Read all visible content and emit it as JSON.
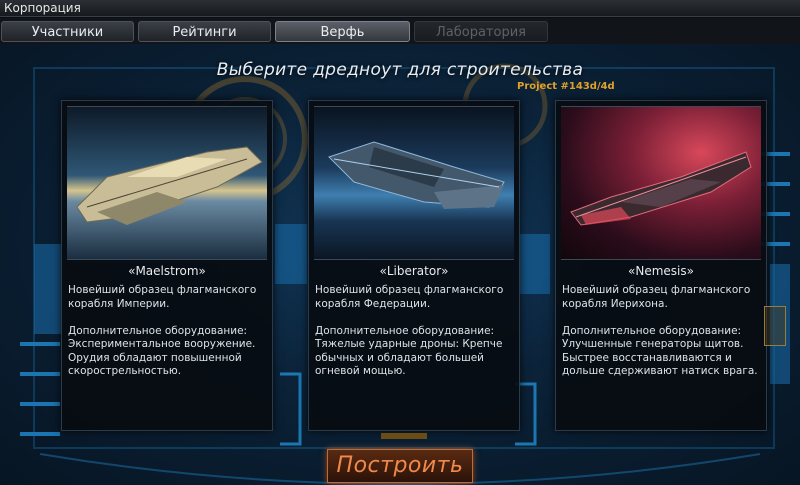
{
  "window": {
    "title": "Корпорация"
  },
  "tabs": [
    {
      "label": "Участники",
      "state": "normal"
    },
    {
      "label": "Рейтинги",
      "state": "normal"
    },
    {
      "label": "Верфь",
      "state": "active"
    },
    {
      "label": "Лаборатория",
      "state": "disabled"
    }
  ],
  "heading": "Выберите дредноут для строительства",
  "project": "Project #143d/4d",
  "ships": [
    {
      "name": "«Maelstrom»",
      "description": "Новейший образец флагманского корабля Империи.\n\nДополнительное оборудование: Экспериментальное вооружение. Орудия обладают повышенной скорострельностью."
    },
    {
      "name": "«Liberator»",
      "description": "Новейший образец флагманского корабля Федерации.\n\nДополнительное оборудование: Тяжелые ударные дроны: Крепче обычных и обладают большей огневой мощью."
    },
    {
      "name": "«Nemesis»",
      "description": "Новейший образец флагманского корабля Иерихона.\n\nДополнительное оборудование: Улучшенные генераторы щитов. Быстрее восстанавливаются и дольше сдерживают натиск врага."
    }
  ],
  "build_button": "Построить",
  "colors": {
    "accent_orange": "#e0a12a",
    "build_text": "#ef8a4b",
    "blueprint_blue": "#1c7bb8"
  }
}
